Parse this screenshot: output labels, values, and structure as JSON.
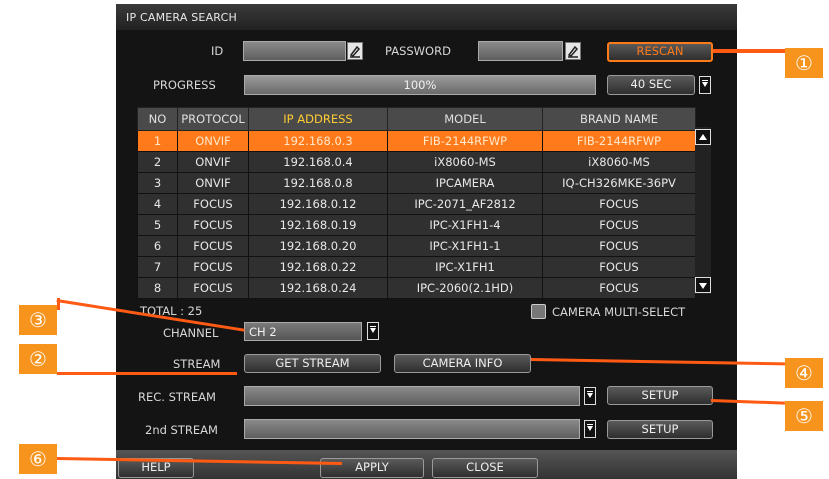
{
  "window": {
    "title": "IP CAMERA SEARCH"
  },
  "credentials": {
    "id_label": "ID",
    "id_value": "",
    "password_label": "PASSWORD",
    "password_value": "",
    "rescan_button": "RESCAN"
  },
  "progress": {
    "label": "PROGRESS",
    "value_text": "100%",
    "percent": 100,
    "timeout": "40 SEC"
  },
  "table": {
    "columns": [
      "NO",
      "PROTOCOL",
      "IP ADDRESS",
      "MODEL",
      "BRAND NAME"
    ],
    "rows": [
      [
        "1",
        "ONVIF",
        "192.168.0.3",
        "FIB-2144RFWP",
        "FIB-2144RFWP"
      ],
      [
        "2",
        "ONVIF",
        "192.168.0.4",
        "iX8060-MS",
        "iX8060-MS"
      ],
      [
        "3",
        "ONVIF",
        "192.168.0.8",
        "IPCAMERA",
        "IQ-CH326MKE-36PV"
      ],
      [
        "4",
        "FOCUS",
        "192.168.0.12",
        "IPC-2071_AF2812",
        "FOCUS"
      ],
      [
        "5",
        "FOCUS",
        "192.168.0.19",
        "IPC-X1FH1-4",
        "FOCUS"
      ],
      [
        "6",
        "FOCUS",
        "192.168.0.20",
        "IPC-X1FH1-1",
        "FOCUS"
      ],
      [
        "7",
        "FOCUS",
        "192.168.0.22",
        "IPC-X1FH1",
        "FOCUS"
      ],
      [
        "8",
        "FOCUS",
        "192.168.0.24",
        "IPC-2060(2.1HD)",
        "FOCUS"
      ]
    ],
    "selected_row": 0,
    "total": "TOTAL : 25"
  },
  "multi_select": {
    "label": "CAMERA MULTI-SELECT",
    "checked": false
  },
  "channel": {
    "label": "CHANNEL",
    "value": "CH 2"
  },
  "stream": {
    "label": "STREAM",
    "get_stream_button": "GET STREAM",
    "camera_info_button": "CAMERA INFO"
  },
  "rec_stream": {
    "label": "REC. STREAM",
    "value": "",
    "setup_button": "SETUP"
  },
  "second_stream": {
    "label": "2nd STREAM",
    "value": "",
    "setup_button": "SETUP"
  },
  "footer": {
    "help_button": "HELP",
    "apply_button": "APPLY",
    "close_button": "CLOSE"
  },
  "callouts": [
    "①",
    "②",
    "③",
    "④",
    "⑤",
    "⑥"
  ],
  "colors": {
    "accent": "#ff7a1a",
    "callout": "#f7941d",
    "header_highlight": "#ffcc33"
  }
}
